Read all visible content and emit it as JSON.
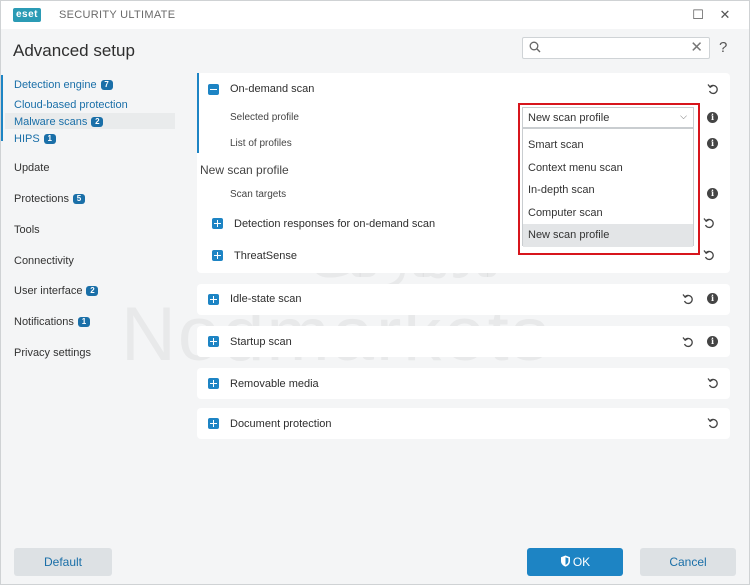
{
  "titlebar": {
    "logo": "eset",
    "app_name": "SECURITY ULTIMATE",
    "minimize_icon": "maximize-icon",
    "close_icon": "close-icon"
  },
  "header": {
    "title": "Advanced setup",
    "search": {
      "value": "",
      "placeholder": ""
    },
    "help": "?"
  },
  "sidebar": {
    "items": [
      {
        "label": "Detection engine",
        "badge": "7"
      },
      {
        "label": "Cloud-based protection",
        "badge": ""
      },
      {
        "label": "Malware scans",
        "badge": "2"
      },
      {
        "label": "HIPS",
        "badge": "1"
      },
      {
        "label": "Update",
        "badge": ""
      },
      {
        "label": "Protections",
        "badge": "5"
      },
      {
        "label": "Tools",
        "badge": ""
      },
      {
        "label": "Connectivity",
        "badge": ""
      },
      {
        "label": "User interface",
        "badge": "2"
      },
      {
        "label": "Notifications",
        "badge": "1"
      },
      {
        "label": "Privacy settings",
        "badge": ""
      }
    ]
  },
  "on_demand": {
    "title": "On-demand scan",
    "selected_profile_label": "Selected profile",
    "list_of_profiles_label": "List of profiles",
    "floating_profile_name": "New scan profile",
    "scan_targets_label": "Scan targets",
    "detection_responses": "Detection responses for on-demand scan",
    "threatsense": "ThreatSense"
  },
  "profile_select": {
    "value": "New scan profile",
    "options": [
      "Smart scan",
      "Context menu scan",
      "In-depth scan",
      "Computer scan",
      "New scan profile"
    ],
    "selected_index": 4
  },
  "sections": [
    {
      "title": "Idle-state scan"
    },
    {
      "title": "Startup scan"
    },
    {
      "title": "Removable media"
    },
    {
      "title": "Document protection"
    }
  ],
  "watermark": {
    "latin": "Nodmarkets",
    "persian": "نادمارکت"
  },
  "footer": {
    "default": "Default",
    "ok": "OK",
    "cancel": "Cancel"
  },
  "colors": {
    "accent": "#1d84c4",
    "highlight_frame": "#d7151c",
    "background": "#f4f5f6"
  }
}
